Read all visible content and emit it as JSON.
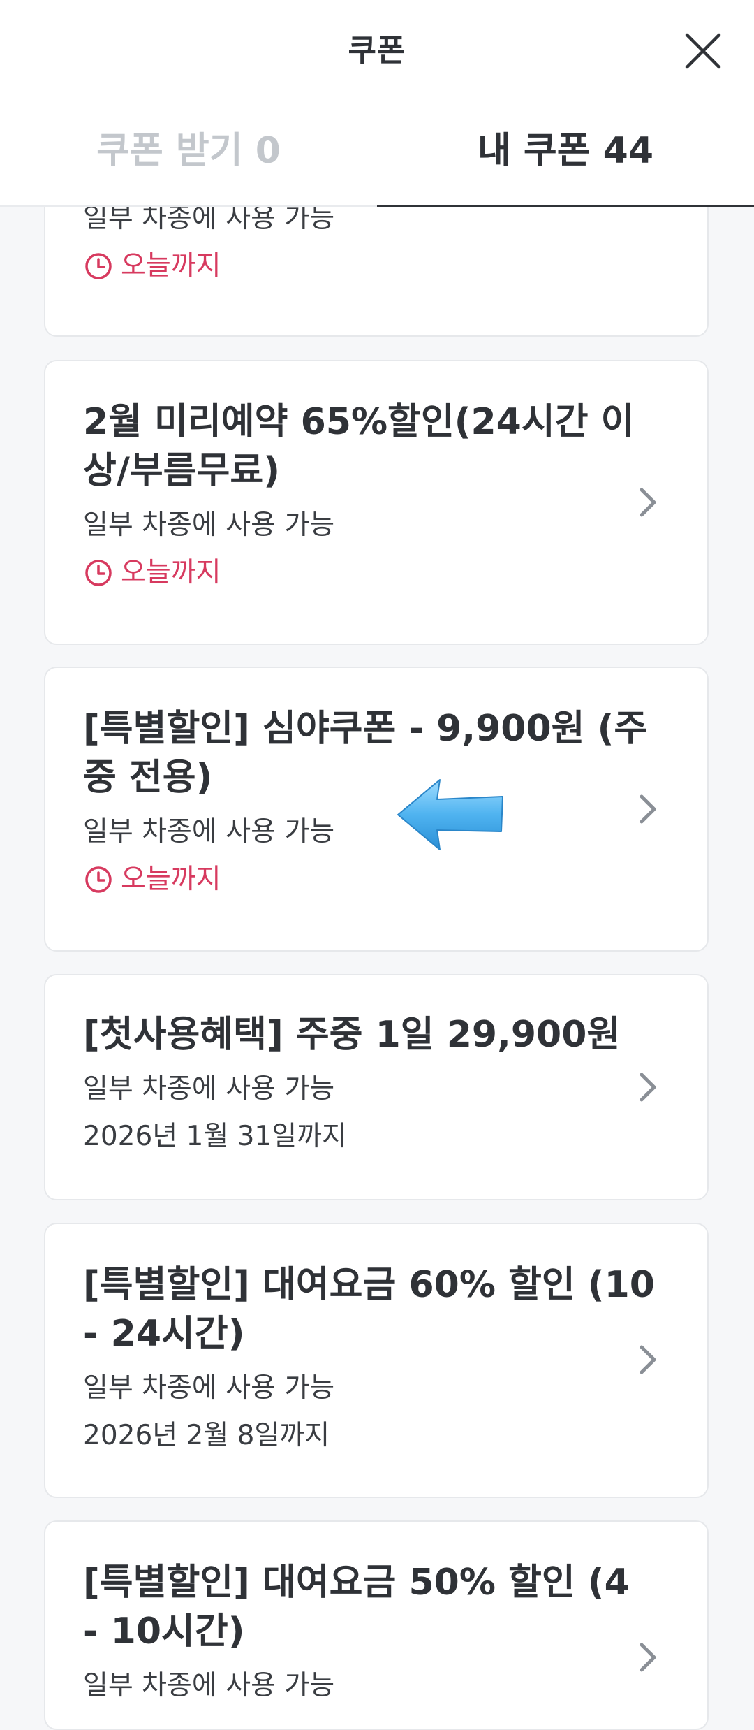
{
  "header": {
    "title": "쿠폰",
    "close_icon": "close-icon"
  },
  "tabs": [
    {
      "label": "쿠폰 받기 0",
      "selected": false
    },
    {
      "label": "내 쿠폰 44",
      "selected": true
    }
  ],
  "coupons": [
    {
      "title": "",
      "subtitle": "일부 차종에 사용 가능",
      "expiry": "오늘까지",
      "expiry_urgent": true
    },
    {
      "title": "2월 미리예약 65%할인(24시간 이상/부름무료)",
      "subtitle": "일부 차종에 사용 가능",
      "expiry": "오늘까지",
      "expiry_urgent": true
    },
    {
      "title": "[특별할인] 심야쿠폰 - 9,900원 (주중 전용)",
      "subtitle": "일부 차종에 사용 가능",
      "expiry": "오늘까지",
      "expiry_urgent": true
    },
    {
      "title": "[첫사용혜택] 주중 1일 29,900원",
      "subtitle": "일부 차종에 사용 가능",
      "expiry": "2026년 1월 31일까지",
      "expiry_urgent": false
    },
    {
      "title": "[특별할인] 대여요금 60% 할인 (10 - 24시간)",
      "subtitle": "일부 차종에 사용 가능",
      "expiry": "2026년 2월 8일까지",
      "expiry_urgent": false
    },
    {
      "title": "[특별할인] 대여요금 50% 할인 (4 - 10시간)",
      "subtitle": "일부 차종에 사용 가능",
      "expiry": "",
      "expiry_urgent": false
    }
  ],
  "colors": {
    "urgent": "#d73a5f",
    "annotation_arrow": "#4fb3f0",
    "background": "#f6f7f9",
    "text": "#2f3237"
  }
}
